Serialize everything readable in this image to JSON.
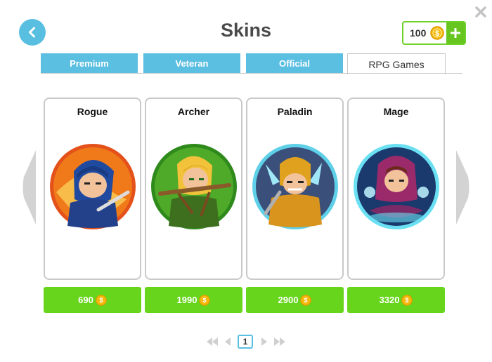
{
  "header": {
    "title": "Skins",
    "wallet_amount": "100",
    "wallet_add_icon": "plus-icon"
  },
  "colors": {
    "accent_blue": "#5bbfe2",
    "buy_green": "#67d51c",
    "coin_gold": "#f5b90c"
  },
  "tabs": [
    {
      "label": "Premium",
      "active": false
    },
    {
      "label": "Veteran",
      "active": false
    },
    {
      "label": "Official",
      "active": false
    },
    {
      "label": "RPG Games",
      "active": true
    }
  ],
  "skins": [
    {
      "name": "Rogue",
      "price": "690"
    },
    {
      "name": "Archer",
      "price": "1990"
    },
    {
      "name": "Paladin",
      "price": "2900"
    },
    {
      "name": "Mage",
      "price": "3320"
    }
  ],
  "pagination": {
    "current_page": "1"
  }
}
